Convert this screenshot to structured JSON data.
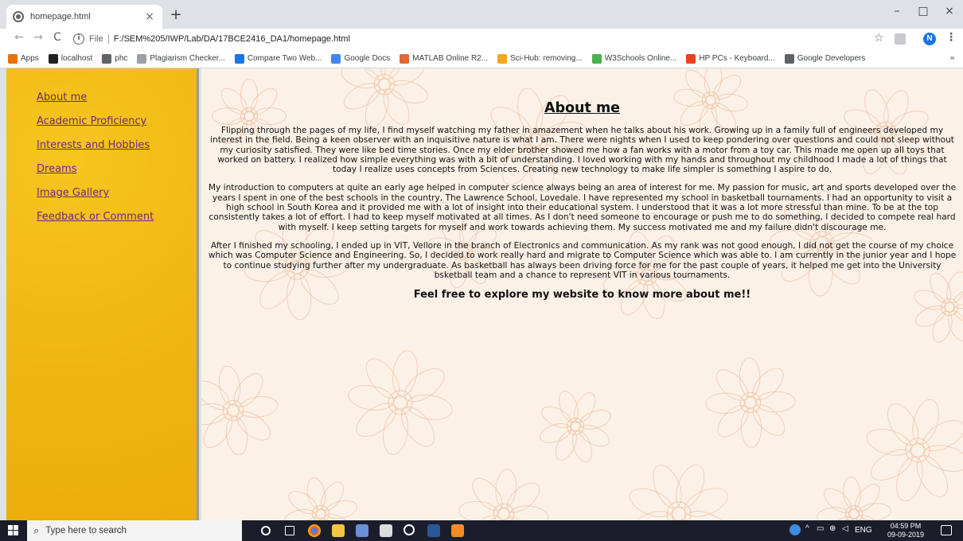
{
  "browser": {
    "tab_title": "homepage.html",
    "tab_close": "×",
    "new_tab": "+",
    "window_controls": {
      "minimize": "–",
      "maximize": "□",
      "close": "×"
    },
    "nav": {
      "back": "←",
      "forward": "→",
      "reload": "C"
    },
    "address": {
      "scheme": "File",
      "url": "F:/SEM%205/IWP/Lab/DA/17BCE2416_DA1/homepage.html"
    },
    "star": "☆",
    "profile_initial": "N",
    "menu": "⋮",
    "bookmarks": [
      {
        "label": "Apps",
        "icon": "apps-grid-icon",
        "color": "#e8710a"
      },
      {
        "label": "localhost",
        "icon": "tools-icon",
        "color": "#202124"
      },
      {
        "label": "phc",
        "icon": "globe-icon",
        "color": "#5f6368"
      },
      {
        "label": "Plagiarism Checker...",
        "icon": "sst-icon",
        "color": "#9aa0a6"
      },
      {
        "label": "Compare Two Web...",
        "icon": "c-logo-icon",
        "color": "#1a73e8"
      },
      {
        "label": "Google Docs",
        "icon": "docs-icon",
        "color": "#4285f4"
      },
      {
        "label": "MATLAB Online R2...",
        "icon": "matlab-icon",
        "color": "#e16737"
      },
      {
        "label": "Sci-Hub: removing...",
        "icon": "scihub-icon",
        "color": "#f5a623"
      },
      {
        "label": "W3Schools Online...",
        "icon": "w3-icon",
        "color": "#4caf50"
      },
      {
        "label": "HP PCs - Keyboard...",
        "icon": "hp-icon",
        "color": "#e8421c"
      },
      {
        "label": "Google Developers",
        "icon": "code-icon",
        "color": "#5f6368"
      }
    ],
    "bookmarks_more": "»"
  },
  "page": {
    "sidebar": {
      "links": [
        "About me",
        "Academic Proficiency",
        "Interests and Hobbies",
        "Dreams",
        "Image Gallery",
        "Feedback or Comment"
      ]
    },
    "heading": "About me",
    "paragraphs": [
      "Flipping through the pages of my life, I find myself watching my father in amazement when he talks about his work. Growing up in a family full of engineers developed my interest in the field. Being a keen observer with an inquisitive nature is what I am. There were nights when I used to keep pondering over questions and could not sleep without my curiosity satisfied. They were like bed time stories. Once my elder brother showed me how a fan works with a motor from a toy car. This made me open up all toys that worked on battery. I realized how simple everything was with a bit of understanding. I loved working with my hands and throughout my childhood I made a lot of things that today I realize uses concepts from Sciences. Creating new technology to make life simpler is something I aspire to do.",
      "My introduction to computers at quite an early age helped in computer science always being an area of interest for me. My passion for music, art and sports developed over the years I spent in one of the best schools in the country, The Lawrence School, Lovedale. I have represented my school in basketball tournaments. I had an opportunity to visit a high school in South Korea and it provided me with a lot of insight into their educational system. I understood that it was a lot more stressful than mine. To be at the top consistently takes a lot of effort. I had to keep myself motivated at all times. As I don't need someone to encourage or push me to do something, I decided to compete real hard with myself. I keep setting targets for myself and work towards achieving them. My success motivated me and my failure didn't discourage me.",
      "After I finished my schooling, I ended up in VIT, Vellore in the branch of Electronics and communication. As my rank was not good enough, I did not get the course of my choice which was Computer Science and Engineering. So, I decided to work really hard and migrate to Computer Science which was able to. I am currently in the junior year and I hope to continue studying further after my undergraduate. As basketball has always been driving force for me for the past couple of years, it helped me get into the University bsketball team and a chance to represent VIT in various tournaments."
    ],
    "closing": "Feel free to explore my website to know more about me!!"
  },
  "taskbar": {
    "search_placeholder": "Type here to search",
    "tray_language": "ENG",
    "time": "04:59 PM",
    "date": "09-09-2019"
  },
  "colors": {
    "sidebar_bg": "#f0b512",
    "link": "#6a2a7a",
    "content_bg": "#fbf1e7",
    "floral_line": "#e8a87c"
  }
}
